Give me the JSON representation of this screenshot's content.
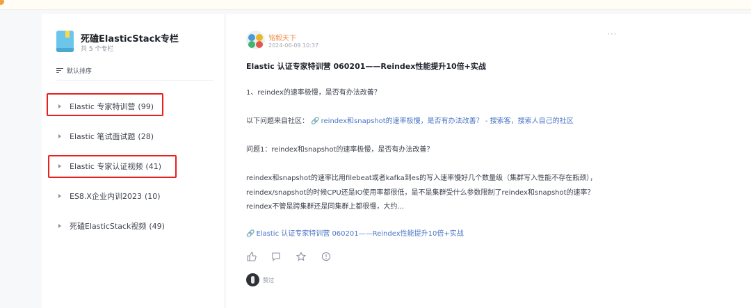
{
  "column": {
    "title": "死磕ElasticStack专栏",
    "subtitle": "共 5 个专栏",
    "sort_label": "默认排序",
    "items": [
      {
        "label": "Elastic 专家特训营",
        "count": "(99)"
      },
      {
        "label": "Elastic 笔试面试题",
        "count": "(28)"
      },
      {
        "label": "Elastic 专家认证视频",
        "count": "(41)"
      },
      {
        "label": "ES8.X企业内训2023",
        "count": "(10)"
      },
      {
        "label": "死磕ElasticStack视频",
        "count": "(49)"
      }
    ]
  },
  "post": {
    "author": "铭毅天下",
    "date": "2024-06-09 10:37",
    "more_label": "···",
    "title": "Elastic 认证专家特训营 060201——Reindex性能提升10倍+实战",
    "question": "1、reindex的速率极慢，是否有办法改善？",
    "source_prefix": "以下问题来自社区：",
    "source_link": "reindex和snapshot的速率极慢，是否有办法改善？ - 搜索客，搜索人自己的社区",
    "q1": "问题1：reindex和snapshot的速率极慢，是否有办法改善？",
    "body_lines": [
      "reindex和snapshot的速率比用filebeat或者kafka到es的写入速率慢好几个数量级（集群写入性能不存在瓶颈），",
      "reindex/snapshot的时候CPU还是IO使用率都很低，是不是集群受什么参数限制了reindex和snapshot的速率？",
      "reindex不管是跨集群还是同集群上都很慢，大约..."
    ],
    "bottom_link": "Elastic 认证专家特训营 060201——Reindex性能提升10倍+实战",
    "liked_label": "赞过"
  },
  "colors": {
    "accent_link": "#4b75c5",
    "author": "#f08c4a",
    "highlight_box": "#e81f1f"
  }
}
